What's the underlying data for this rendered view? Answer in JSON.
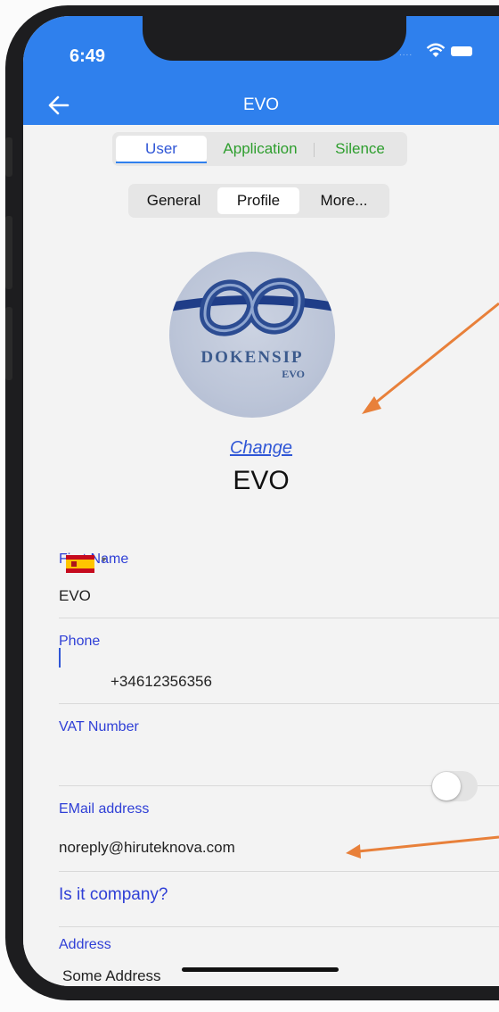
{
  "status_bar": {
    "time": "6:49"
  },
  "nav": {
    "title": "EVO"
  },
  "tabs_primary": [
    {
      "label": "User",
      "active": true,
      "color": "#2f56d6"
    },
    {
      "label": "Application",
      "active": false,
      "color": "#2e9e2e"
    },
    {
      "label": "Silence",
      "active": false,
      "color": "#2e9e2e"
    }
  ],
  "tabs_secondary": [
    {
      "label": "General",
      "active": false
    },
    {
      "label": "Profile",
      "active": true
    },
    {
      "label": "More...",
      "active": false
    }
  ],
  "profile": {
    "logo_text": "DOKENSIP",
    "logo_subtext": "EVO",
    "change_label": "Change",
    "name": "EVO"
  },
  "form": {
    "first_name_label": "First Name",
    "first_name_value": "EVO",
    "phone_label": "Phone",
    "phone_value": "+34612356356",
    "vat_label": "VAT Number",
    "vat_value": "",
    "email_label": "EMail address",
    "email_value": "noreply@hiruteknova.com",
    "company_label": "Is it company?",
    "company_on": false,
    "address_label": "Address",
    "address_value": "Some Address"
  },
  "colors": {
    "accent": "#2f80ed",
    "label_blue": "#2f3fd6",
    "annotation_arrow": "#e8803a"
  }
}
